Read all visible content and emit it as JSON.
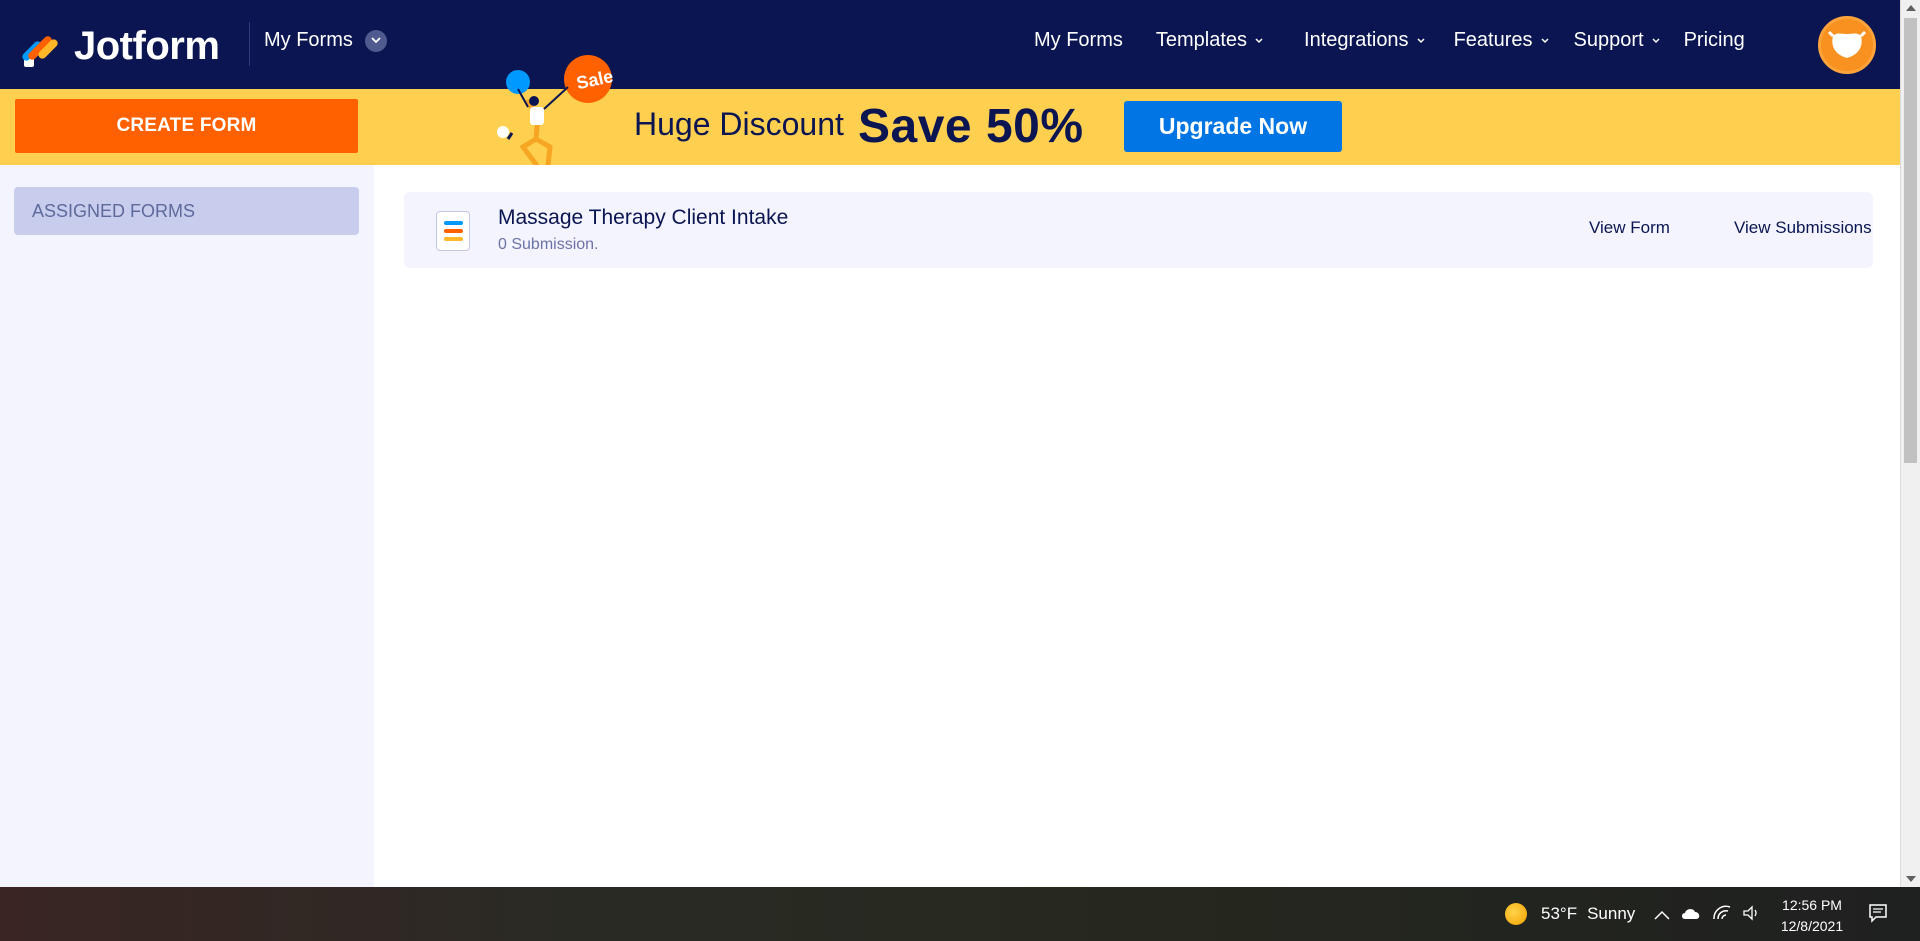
{
  "header": {
    "logo_text": "Jotform",
    "myforms_dropdown": "My Forms",
    "nav": [
      {
        "label": "My Forms",
        "has_chevron": false
      },
      {
        "label": "Templates",
        "has_chevron": true
      },
      {
        "label": "Integrations",
        "has_chevron": true
      },
      {
        "label": "Features",
        "has_chevron": true
      },
      {
        "label": "Support",
        "has_chevron": true
      },
      {
        "label": "Pricing",
        "has_chevron": false
      }
    ]
  },
  "promo": {
    "create_button": "CREATE FORM",
    "sale_badge": "Sale",
    "headline": "Huge Discount",
    "save_text": "Save 50%",
    "upgrade_button": "Upgrade Now"
  },
  "sidebar": {
    "assigned_tab": "ASSIGNED FORMS"
  },
  "forms": [
    {
      "title": "Massage Therapy Client Intake",
      "submissions": "0 Submission.",
      "view_form": "View Form",
      "view_submissions": "View Submissions"
    }
  ],
  "taskbar": {
    "weather_temp": "53°F",
    "weather_cond": "Sunny",
    "time": "12:56 PM",
    "date": "12/8/2021"
  },
  "colors": {
    "nav_bg": "#0a1551",
    "promo_bg": "#ffd04f",
    "create_button": "#ff6100",
    "upgrade_button": "#0075e3",
    "sidebar_bg": "#f3f4fd",
    "assigned_tab_bg": "#c8cdee",
    "avatar": "#f8911f"
  },
  "icons": {
    "logo": "jotform-logo-icon",
    "dropdown": "chevron-down-icon",
    "avatar": "user-avatar-icon",
    "form": "form-document-icon",
    "weather": "sun-icon",
    "notifications": "notification-icon"
  }
}
